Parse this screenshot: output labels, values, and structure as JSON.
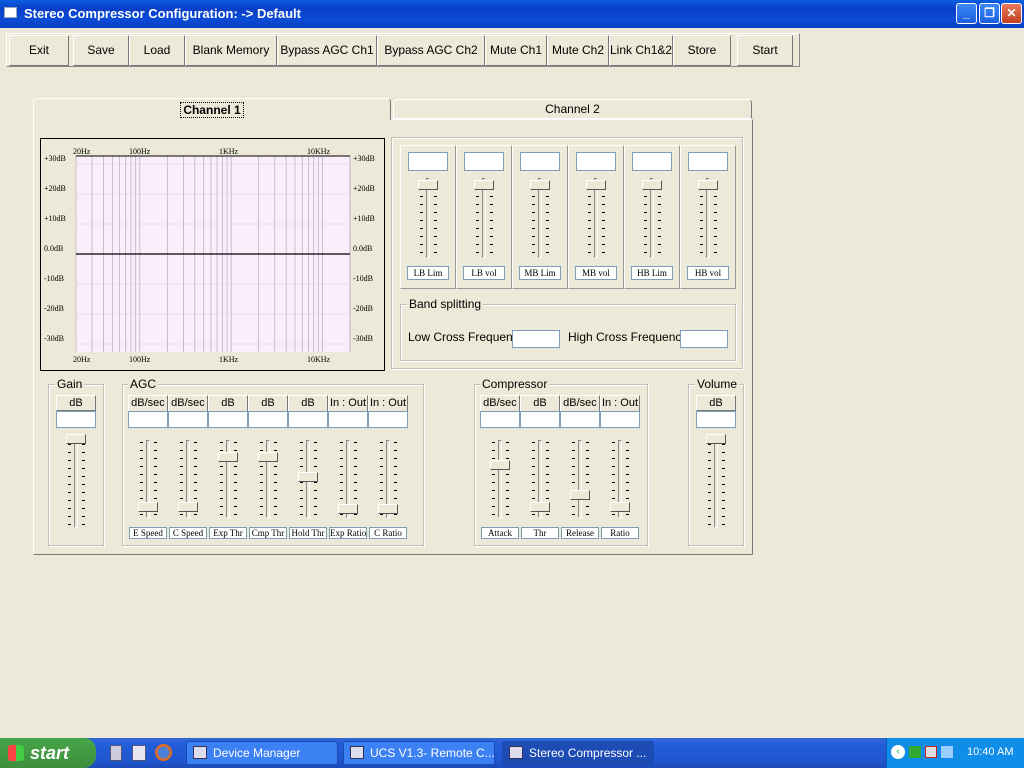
{
  "window": {
    "title": "Stereo Compressor  Configuration: -> Default"
  },
  "toolbar": [
    {
      "label": "Exit"
    },
    {
      "label": "Save"
    },
    {
      "label": "Load"
    },
    {
      "label": "Blank Memory"
    },
    {
      "label": "Bypass AGC  Ch1"
    },
    {
      "label": "Bypass AGC Ch2"
    },
    {
      "label": "Mute Ch1"
    },
    {
      "label": "Mute Ch2"
    },
    {
      "label": "Link Ch1&2"
    },
    {
      "label": "Store"
    },
    {
      "label": "Start"
    }
  ],
  "tabs": [
    {
      "label": "Channel 1"
    },
    {
      "label": "Channel 2"
    }
  ],
  "graph": {
    "freq_labels": [
      "20Hz",
      "100Hz",
      "1KHz",
      "10KHz"
    ],
    "db_labels": [
      "+30dB",
      "+20dB",
      "+10dB",
      "0.0dB",
      "-10dB",
      "-20dB",
      "-30dB"
    ]
  },
  "bands": {
    "labels": [
      "LB Lim",
      "LB vol",
      "MB Lim",
      "MB vol",
      "HB Lim",
      "HB vol"
    ]
  },
  "band_splitting": {
    "title": "Band splitting",
    "low_label": "Low Cross Frequency",
    "high_label": "High Cross Frequency"
  },
  "gain": {
    "title": "Gain",
    "unit": "dB"
  },
  "agc": {
    "title": "AGC",
    "units": [
      "dB/sec",
      "dB/sec",
      "dB",
      "dB",
      "dB",
      "In : Out",
      "In : Out"
    ],
    "labels": [
      "E Speed",
      "C Speed",
      "Exp Thr",
      "Cmp Thr",
      "Hold Thr",
      "Exp Ratio",
      "C Ratio"
    ]
  },
  "compressor": {
    "title": "Compressor",
    "units": [
      "dB/sec",
      "dB",
      "dB/sec",
      "In : Out"
    ],
    "labels": [
      "Attack",
      "Thr",
      "Release",
      "Ratio"
    ]
  },
  "volume": {
    "title": "Volume",
    "unit": "dB"
  },
  "taskbar": {
    "start": "start",
    "tasks": [
      {
        "label": "Device Manager"
      },
      {
        "label": "UCS V1.3- Remote C..."
      },
      {
        "label": "Stereo Compressor  ..."
      }
    ],
    "clock": "10:40 AM"
  }
}
